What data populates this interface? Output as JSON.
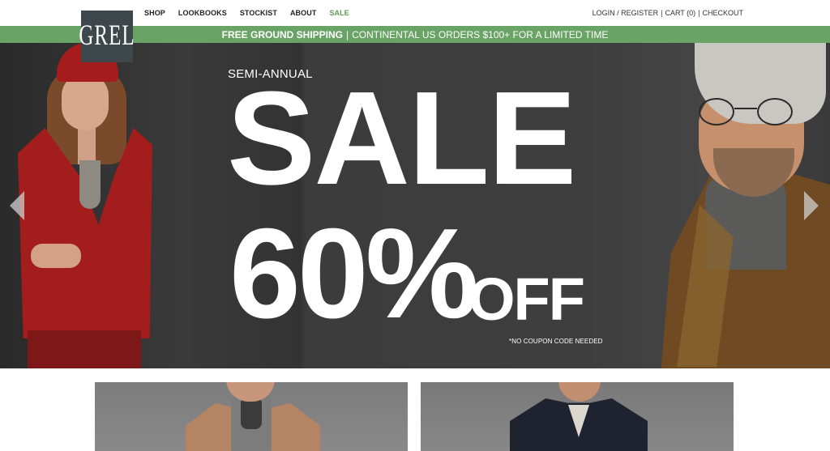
{
  "brand": {
    "logo_text": "GREL"
  },
  "nav": [
    {
      "label": "SHOP"
    },
    {
      "label": "LOOKBOOKS"
    },
    {
      "label": "STOCKIST"
    },
    {
      "label": "ABOUT"
    },
    {
      "label": "SALE",
      "color": "#5d9e4c"
    }
  ],
  "account": {
    "login": "LOGIN / REGISTER",
    "sep1": "|",
    "cart": "CART (0)",
    "sep2": "|",
    "checkout": "CHECKOUT"
  },
  "promo": {
    "bold": "FREE GROUND SHIPPING",
    "sep": "|",
    "text": "CONTINENTAL US ORDERS $100+ FOR A LIMITED TIME",
    "background": "#6aa366"
  },
  "hero": {
    "eyebrow": "SEMI-ANNUAL",
    "headline": "SALE",
    "discount": "60%",
    "off": "OFF",
    "note": "*NO COUPON CODE NEEDED",
    "prev_icon": "chevron-left-icon",
    "next_icon": "chevron-right-icon"
  },
  "colors": {
    "accent_green": "#6aa366",
    "logo_bg": "#3d474c"
  }
}
